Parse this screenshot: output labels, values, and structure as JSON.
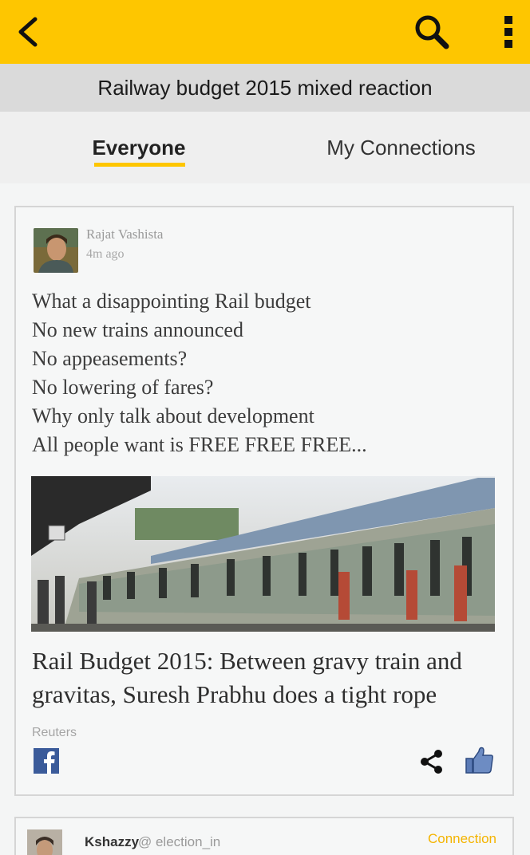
{
  "appbar": {
    "back_icon": "back-arrow-icon",
    "search_icon": "search-icon",
    "menu_icon": "overflow-menu-icon",
    "color": "#fec600"
  },
  "topic": {
    "title": "Railway budget 2015 mixed reaction"
  },
  "tabs": [
    {
      "label": "Everyone",
      "active": true
    },
    {
      "label": "My Connections",
      "active": false
    }
  ],
  "post": {
    "author": "Rajat  Vashista",
    "time": "4m ago",
    "lines": [
      "What a disappointing Rail budget",
      "No new trains announced",
      "No  appeasements?",
      "No lowering of fares?",
      "Why only talk about development",
      "All people want is FREE FREE FREE..."
    ],
    "article": {
      "title": "Rail Budget 2015: Between gravy train and gravitas, Suresh Prabhu does a tight rope",
      "source": "Reuters"
    },
    "actions": {
      "facebook_icon": "facebook-icon",
      "share_icon": "share-icon",
      "like_icon": "like-icon"
    }
  },
  "next_post": {
    "author": "Kshazzy",
    "handle": "@ election_in",
    "badge": "Connection"
  }
}
